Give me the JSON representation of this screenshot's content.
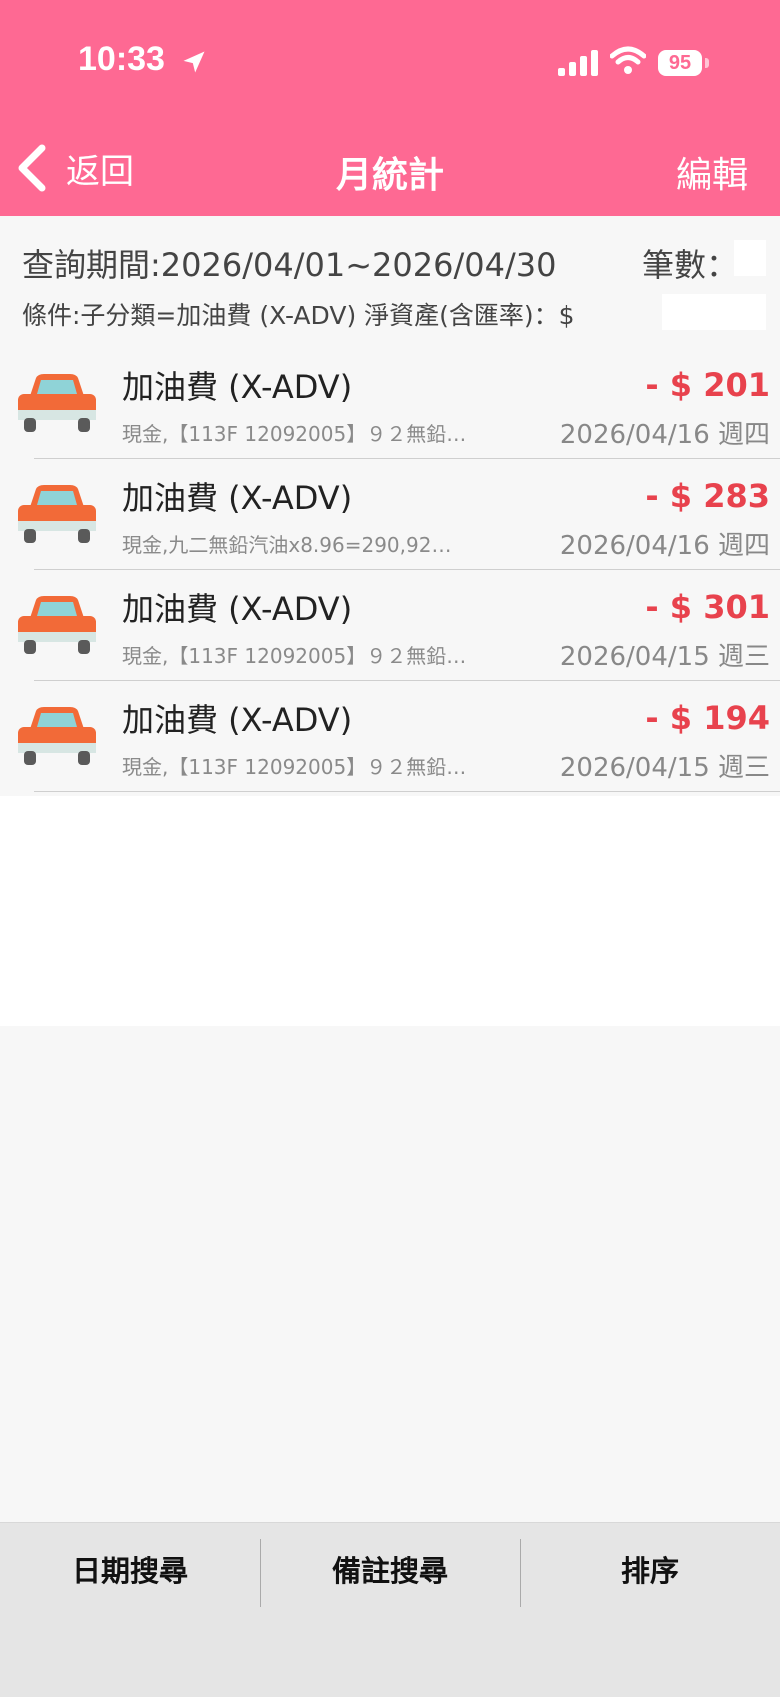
{
  "status_bar": {
    "time": "10:33",
    "battery": "95"
  },
  "nav": {
    "back_label": "返回",
    "title": "月統計",
    "edit_label": "編輯"
  },
  "summary": {
    "query_period": "查詢期間:2026/04/01~2026/04/30",
    "count_label": "筆數：",
    "condition": "條件:子分類=加油費 (X-ADV) 淨資產(含匯率)：$"
  },
  "transactions": [
    {
      "title": "加油費 (X-ADV)",
      "amount": "- $ 201",
      "note": "現金,【113F 12092005】９２無鉛…",
      "date": "2026/04/16 週四",
      "icon": "car-icon"
    },
    {
      "title": "加油費 (X-ADV)",
      "amount": "- $ 283",
      "note": "現金,九二無鉛汽油x8.96=290,92…",
      "date": "2026/04/16 週四",
      "icon": "car-icon"
    },
    {
      "title": "加油費 (X-ADV)",
      "amount": "- $ 301",
      "note": "現金,【113F 12092005】９２無鉛…",
      "date": "2026/04/15 週三",
      "icon": "car-icon"
    },
    {
      "title": "加油費 (X-ADV)",
      "amount": "- $ 194",
      "note": "現金,【113F 12092005】９２無鉛…",
      "date": "2026/04/15 週三",
      "icon": "car-icon"
    }
  ],
  "tabs": {
    "date_search": "日期搜尋",
    "note_search": "備註搜尋",
    "sort": "排序"
  },
  "colors": {
    "header": "#fe6993",
    "amount_negative": "#e8424d",
    "tabbar": "#e5e5e5"
  }
}
